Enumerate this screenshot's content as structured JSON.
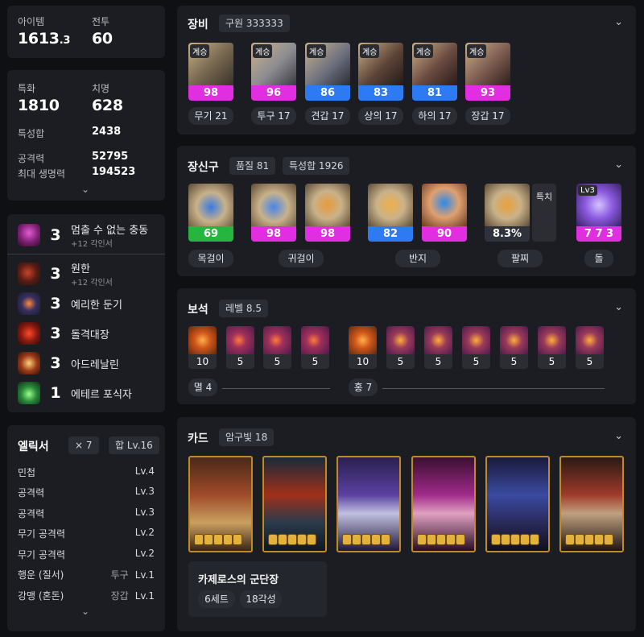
{
  "summary": {
    "item_label": "아이템",
    "item_value": "1613",
    "item_decimal": ".3",
    "combat_label": "전투",
    "combat_value": "60"
  },
  "stats": {
    "spec_label": "특화",
    "spec_value": "1810",
    "crit_label": "치명",
    "crit_value": "628",
    "trait_label": "특성합",
    "trait_value": "2438",
    "atk_label": "공격력",
    "atk_value": "52795",
    "hp_label": "최대 생명력",
    "hp_value": "194523"
  },
  "engravings": [
    {
      "level": "3",
      "name": "멈출 수 없는 충동",
      "sub": "+12 각인서",
      "icon": "engraving-impulse-icon"
    },
    {
      "level": "3",
      "name": "원한",
      "sub": "+12 각인서",
      "icon": "engraving-grudge-icon"
    },
    {
      "level": "3",
      "name": "예리한 둔기",
      "sub": "",
      "icon": "engraving-keen-blunt-icon"
    },
    {
      "level": "3",
      "name": "돌격대장",
      "sub": "",
      "icon": "engraving-vanguard-icon"
    },
    {
      "level": "3",
      "name": "아드레날린",
      "sub": "",
      "icon": "engraving-adrenaline-icon"
    },
    {
      "level": "1",
      "name": "에테르 포식자",
      "sub": "",
      "icon": "engraving-ether-predator-icon"
    }
  ],
  "elixir": {
    "title": "엘릭서",
    "count": "× 7",
    "total": "합 Lv.16",
    "rows": [
      {
        "name": "민첩",
        "slot": "",
        "level": "Lv.4"
      },
      {
        "name": "공격력",
        "slot": "",
        "level": "Lv.3"
      },
      {
        "name": "공격력",
        "slot": "",
        "level": "Lv.3"
      },
      {
        "name": "무기 공격력",
        "slot": "",
        "level": "Lv.2"
      },
      {
        "name": "무기 공격력",
        "slot": "",
        "level": "Lv.2"
      },
      {
        "name": "행운 (질서)",
        "slot": "투구",
        "level": "Lv.1"
      },
      {
        "name": "강맹 (혼돈)",
        "slot": "장갑",
        "level": "Lv.1"
      }
    ]
  },
  "equipment": {
    "title": "장비",
    "badge": "구원 333333",
    "items": [
      {
        "tier": "계승",
        "quality": "98",
        "label": "무기 21",
        "color": "mag"
      },
      {
        "tier": "계승",
        "quality": "96",
        "label": "투구 17",
        "color": "mag"
      },
      {
        "tier": "계승",
        "quality": "86",
        "label": "견갑 17",
        "color": "blue"
      },
      {
        "tier": "계승",
        "quality": "83",
        "label": "상의 17",
        "color": "blue"
      },
      {
        "tier": "계승",
        "quality": "81",
        "label": "하의 17",
        "color": "blue"
      },
      {
        "tier": "계승",
        "quality": "93",
        "label": "장갑 17",
        "color": "mag"
      }
    ]
  },
  "accessories": {
    "title": "장신구",
    "quality_badge": "품질 81",
    "trait_badge": "특성합 1926",
    "items": [
      {
        "quality": "69",
        "color": "green"
      },
      {
        "quality": "98",
        "color": "mag"
      },
      {
        "quality": "98",
        "color": "mag"
      },
      {
        "quality": "82",
        "color": "blue"
      },
      {
        "quality": "90",
        "color": "mag"
      },
      {
        "quality": "8.3%",
        "color": "gray"
      },
      {
        "quality": "7 7 3",
        "color": "mag"
      }
    ],
    "bracelet_stat": "특치",
    "stone_level": "Lv3",
    "labels": [
      "목걸이",
      "귀걸이",
      "반지",
      "팔찌",
      "돌"
    ]
  },
  "gems": {
    "title": "보석",
    "level_badge": "레벨 8.5",
    "annihilation": [
      "10",
      "5",
      "5",
      "5"
    ],
    "crimson": [
      "10",
      "5",
      "5",
      "5",
      "5",
      "5",
      "5"
    ],
    "annihilation_label": "멸 4",
    "crimson_label": "홍 7"
  },
  "cards": {
    "title": "카드",
    "awaken_badge": "암구빛 18",
    "set_name": "카제로스의 군단장",
    "set_count": "6세트",
    "awakening": "18각성",
    "stars_per_card": 5
  },
  "colors": {
    "magenta": "#e12ee0",
    "blue": "#2e7af2",
    "green": "#26b640",
    "panel": "#1b1d22",
    "background": "#0f1013"
  }
}
